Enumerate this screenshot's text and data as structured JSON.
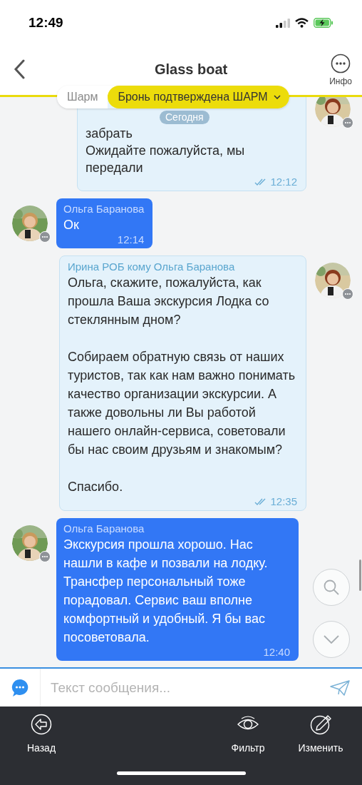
{
  "status_bar": {
    "time": "12:49"
  },
  "header": {
    "title": "Glass boat",
    "info_label": "Инфо"
  },
  "filter": {
    "region": "Шарм",
    "status": "Бронь подтверждена ШАРМ"
  },
  "date_chip": "Сегодня",
  "messages": [
    {
      "kind": "outgoing",
      "text": "забрать\nОжидайте пожалуйста, мы передали",
      "time": "12:12",
      "read": true
    },
    {
      "kind": "incoming",
      "sender": "Ольга Баранова",
      "text": "Ок",
      "time": "12:14",
      "read": false
    },
    {
      "kind": "outgoing",
      "sender": "Ирина РОБ кому Ольга Баранова",
      "text": "Ольга, скажите, пожалуйста, как прошла Ваша экскурсия Лодка со стеклянным дном?\n\nСобираем обратную связь от наших туристов, так как нам важно понимать качество организации экскурсии. А также довольны ли Вы работой нашего онлайн-сервиса, советовали бы нас своим друзьям и знакомым?\n\nСпасибо.",
      "time": "12:35",
      "read": true
    },
    {
      "kind": "incoming",
      "sender": "Ольга Баранова",
      "text": "Экскурсия прошла хорошо. Нас нашли в кафе и позвали на лодку. Трансфер персональный тоже порадовал. Сервис ваш вполне комфортный и удобный. Я бы вас посоветовала.",
      "time": "12:40",
      "read": false
    }
  ],
  "composer": {
    "placeholder": "Текст сообщения..."
  },
  "bottom_nav": [
    {
      "kind": "back",
      "label": "Назад"
    },
    {
      "kind": "filter",
      "label": "Фильтр"
    },
    {
      "kind": "edit",
      "label": "Изменить"
    }
  ]
}
